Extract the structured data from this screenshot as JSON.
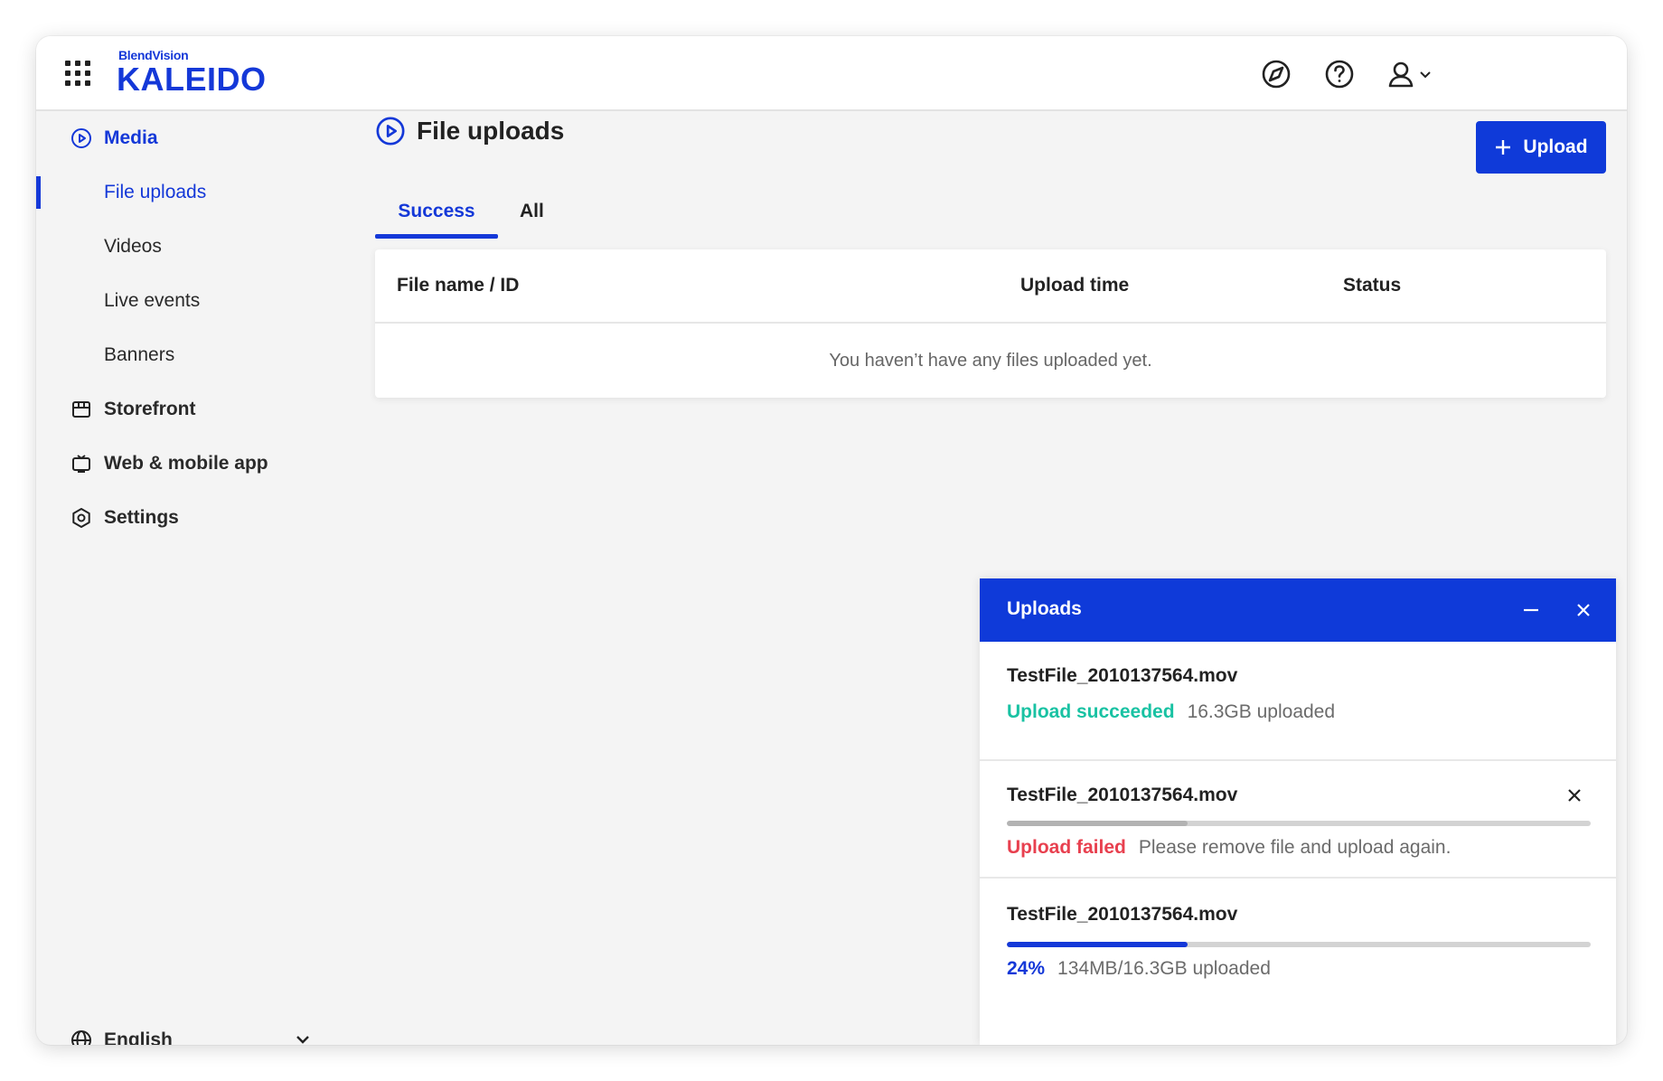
{
  "brand": {
    "small": "BlendVision",
    "name": "KALEIDO"
  },
  "header_icons": [
    "compass-icon",
    "help-icon",
    "user-icon"
  ],
  "sidebar": {
    "media": "Media",
    "items": [
      "File uploads",
      "Videos",
      "Live events",
      "Banners"
    ],
    "storefront": "Storefront",
    "webapp": "Web & mobile app",
    "settings": "Settings",
    "language": "English"
  },
  "main": {
    "title": "File uploads",
    "upload_button": "Upload",
    "tabs": [
      "Success",
      "All"
    ],
    "table": {
      "columns": [
        "File name / ID",
        "Upload time",
        "Status"
      ],
      "empty": "You haven’t have any files uploaded yet."
    }
  },
  "uploads_panel": {
    "title": "Uploads",
    "items": [
      {
        "name": "TestFile_2010137564.mov",
        "status": "Upload succeeded",
        "detail": "16.3GB uploaded"
      },
      {
        "name": "TestFile_2010137564.mov",
        "status": "Upload failed",
        "detail": "Please remove file and upload again.",
        "progress": 0.31
      },
      {
        "name": "TestFile_2010137564.mov",
        "status": "24%",
        "detail": "134MB/16.3GB uploaded",
        "progress": 0.31
      }
    ]
  },
  "colors": {
    "brand": "#1438d8",
    "success": "#19c2a3",
    "error": "#e8404f"
  }
}
